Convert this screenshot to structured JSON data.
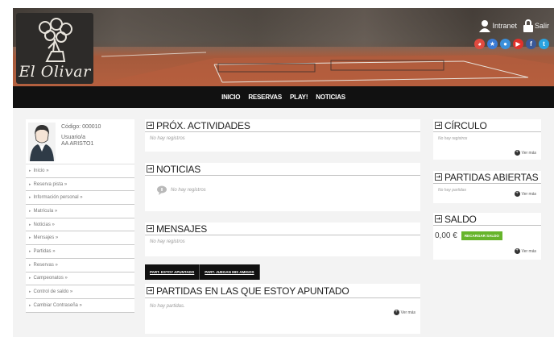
{
  "header": {
    "logo_text": "El Olivar",
    "links": [
      {
        "label": "Intranet",
        "icon": "user-icon"
      },
      {
        "label": "Salir",
        "icon": "lock-icon"
      }
    ],
    "socials": [
      {
        "name": "picasa-icon",
        "glyph": "◕",
        "color": "#e04a3f"
      },
      {
        "name": "star-icon",
        "glyph": "★",
        "color": "#3a7bd5"
      },
      {
        "name": "flickr-icon",
        "glyph": "●",
        "color": "#3b8fd9"
      },
      {
        "name": "youtube-icon",
        "glyph": "▶",
        "color": "#e0312b"
      },
      {
        "name": "facebook-icon",
        "glyph": "f",
        "color": "#3b5998"
      },
      {
        "name": "twitter-icon",
        "glyph": "t",
        "color": "#2aa3e0"
      }
    ]
  },
  "nav": {
    "items": [
      "INICIO",
      "RESERVAS",
      "PLAY!",
      "NOTICIAS"
    ]
  },
  "profile": {
    "code": "Código: 000010",
    "user_line1": "Usuario/a",
    "user_line2": "AA ARISTO1"
  },
  "menu": {
    "items": [
      "Inicio »",
      "Reserva pista »",
      "Información personal »",
      "Matrícula »",
      "Noticias »",
      "Mensajes »",
      "Partidas »",
      "Reservas »",
      "Campeonatos »",
      "Control de saldo »",
      "Cambiar Contraseña »"
    ]
  },
  "panels": {
    "actividades": {
      "title": "PRÓX. ACTIVIDADES",
      "empty": "No hay registros"
    },
    "noticias": {
      "title": "NOTICIAS",
      "empty": "No hay registros"
    },
    "mensajes": {
      "title": "MENSAJES",
      "empty": "No hay registros"
    },
    "tabs": [
      "PART. ESTOY APUNTADO",
      "PART. JUEGAN MIS AMIGOS"
    ],
    "apuntado": {
      "title": "PARTIDAS EN LAS QUE ESTOY APUNTADO",
      "empty": "No hay partidas.",
      "more": "Ver más"
    },
    "circulo": {
      "title": "CÍRCULO",
      "empty": "No hay registros",
      "more": "Ver más"
    },
    "abiertas": {
      "title": "PARTIDAS ABIERTAS",
      "empty": "No hay partidas",
      "more": "Ver más"
    },
    "saldo": {
      "title": "SALDO",
      "value": "0,00 €",
      "button": "RECARGAR SALDO",
      "more": "Ver más"
    }
  }
}
